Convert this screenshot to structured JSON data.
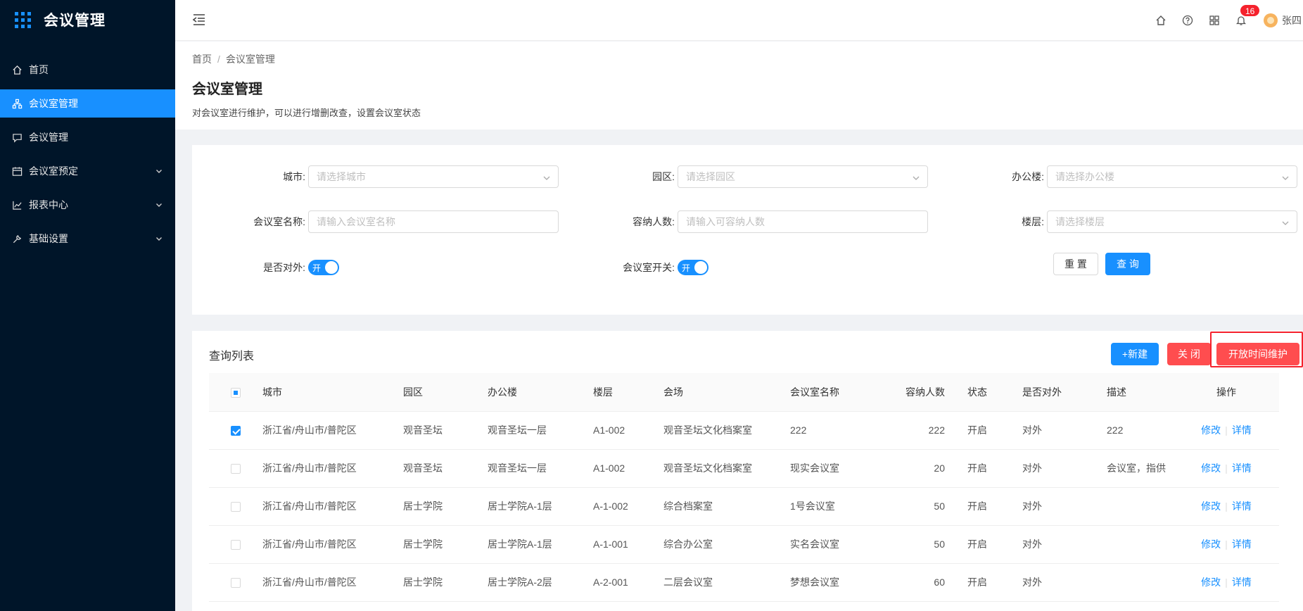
{
  "app": {
    "title": "会议管理"
  },
  "sidebar": {
    "items": [
      {
        "label": "首页",
        "icon": "home-icon",
        "active": false,
        "expandable": false
      },
      {
        "label": "会议室管理",
        "icon": "org-icon",
        "active": true,
        "expandable": false
      },
      {
        "label": "会议管理",
        "icon": "chat-icon",
        "active": false,
        "expandable": false
      },
      {
        "label": "会议室预定",
        "icon": "calendar-icon",
        "active": false,
        "expandable": true
      },
      {
        "label": "报表中心",
        "icon": "chart-icon",
        "active": false,
        "expandable": true
      },
      {
        "label": "基础设置",
        "icon": "wrench-icon",
        "active": false,
        "expandable": true
      }
    ]
  },
  "header": {
    "notification_count": "16",
    "username": "张四"
  },
  "breadcrumb": {
    "home": "首页",
    "separator": "/",
    "current": "会议室管理"
  },
  "page": {
    "title": "会议室管理",
    "description": "对会议室进行维护，可以进行增删改查，设置会议室状态"
  },
  "filters": {
    "city": {
      "label": "城市:",
      "placeholder": "请选择城市"
    },
    "park": {
      "label": "园区:",
      "placeholder": "请选择园区"
    },
    "building": {
      "label": "办公楼:",
      "placeholder": "请选择办公楼"
    },
    "room_name": {
      "label": "会议室名称:",
      "placeholder": "请输入会议室名称"
    },
    "capacity": {
      "label": "容纳人数:",
      "placeholder": "请输入可容纳人数"
    },
    "floor": {
      "label": "楼层:",
      "placeholder": "请选择楼层"
    },
    "external": {
      "label": "是否对外:",
      "value": "开"
    },
    "room_switch": {
      "label": "会议室开关:",
      "value": "开"
    },
    "reset_label": "重 置",
    "query_label": "查 询"
  },
  "list": {
    "title": "查询列表",
    "new_label": "+新建",
    "close_label": "关 闭",
    "maintain_label": "开放时间维护",
    "columns": [
      "城市",
      "园区",
      "办公楼",
      "楼层",
      "会场",
      "会议室名称",
      "容纳人数",
      "状态",
      "是否对外",
      "描述",
      "操作"
    ],
    "edit_label": "修改",
    "detail_label": "详情",
    "rows": [
      {
        "checked": true,
        "city": "浙江省/舟山市/普陀区",
        "park": "观音圣坛",
        "building": "观音圣坛一层",
        "floor": "A1-002",
        "venue": "观音圣坛文化档案室",
        "name": "222",
        "capacity": "222",
        "status": "开启",
        "external": "对外",
        "desc": "222"
      },
      {
        "checked": false,
        "city": "浙江省/舟山市/普陀区",
        "park": "观音圣坛",
        "building": "观音圣坛一层",
        "floor": "A1-002",
        "venue": "观音圣坛文化档案室",
        "name": "现实会议室",
        "capacity": "20",
        "status": "开启",
        "external": "对外",
        "desc": "会议室，指供"
      },
      {
        "checked": false,
        "city": "浙江省/舟山市/普陀区",
        "park": "居士学院",
        "building": "居士学院A-1层",
        "floor": "A-1-002",
        "venue": "综合档案室",
        "name": "1号会议室",
        "capacity": "50",
        "status": "开启",
        "external": "对外",
        "desc": ""
      },
      {
        "checked": false,
        "city": "浙江省/舟山市/普陀区",
        "park": "居士学院",
        "building": "居士学院A-1层",
        "floor": "A-1-001",
        "venue": "综合办公室",
        "name": "实名会议室",
        "capacity": "50",
        "status": "开启",
        "external": "对外",
        "desc": ""
      },
      {
        "checked": false,
        "city": "浙江省/舟山市/普陀区",
        "park": "居士学院",
        "building": "居士学院A-2层",
        "floor": "A-2-001",
        "venue": "二层会议室",
        "name": "梦想会议室",
        "capacity": "60",
        "status": "开启",
        "external": "对外",
        "desc": ""
      }
    ]
  },
  "colors": {
    "sidebar_bg": "#001529",
    "primary": "#1890ff",
    "danger": "#ff4d4f",
    "highlight": "#f5222d"
  }
}
